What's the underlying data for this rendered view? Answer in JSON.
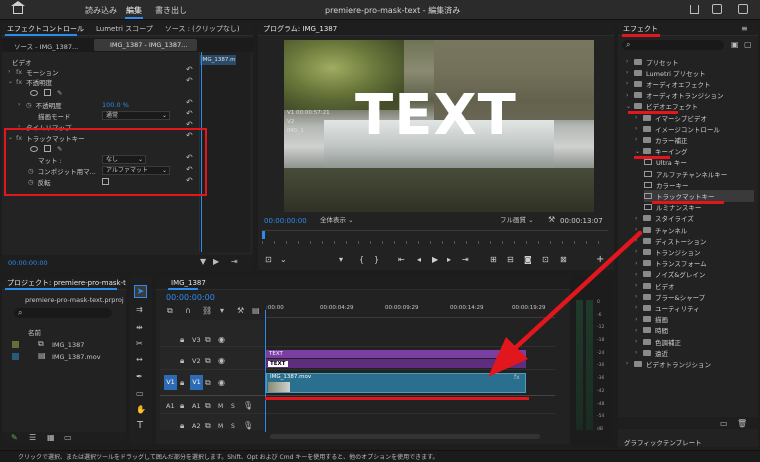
{
  "app": {
    "title": "premiere-pro-mask-text - 編集済み",
    "nav": [
      "読み込み",
      "編集",
      "書き出し"
    ],
    "active_nav": "編集"
  },
  "effect_controls": {
    "tabs": [
      "エフェクトコントロール",
      "Lumetri スコープ",
      "ソース : (クリップなし)"
    ],
    "source_label": "ソース - IMG_1387...",
    "clip_label": "IMG_1387 - IMG_1387...",
    "clip_mini": "IMG_1387.m",
    "video_label": "ビデオ",
    "rows": {
      "motion": "モーション",
      "opacity_section": "不透明度",
      "opacity": "不透明度",
      "opacity_value": "100.0 %",
      "blend": "描画モード",
      "blend_value": "通常",
      "remap": "タイムリマップ",
      "track_matte": "トラックマットキー",
      "matte": "マット :",
      "matte_value": "なし",
      "composite": "コンポジット用マ...",
      "composite_value": "アルファマット",
      "reverse": "反転"
    },
    "timecode": "00:00:00:00"
  },
  "program": {
    "title": "プログラム: IMG_1387",
    "overlay_text": "TEXT",
    "timecode_left": "00:00:00:00",
    "fit": "全体表示",
    "quality": "フル画質",
    "timecode_right": "00:00:13:07",
    "info_lines": [
      "V1 00:00:57:21",
      "V2",
      "IMG_1"
    ]
  },
  "project": {
    "title": "プロジェクト: premiere-pro-mask-text",
    "file": "premiere-pro-mask-text.prproj",
    "col_name": "名前",
    "items": [
      "IMG_1387",
      "IMG_1387.mov"
    ]
  },
  "timeline": {
    "title": "IMG_1387",
    "timecode": "00:00:00:00",
    "ruler": [
      ":00:00",
      "00:00:04:29",
      "00:00:09:29",
      "00:00:14:29",
      "00:00:19:29"
    ],
    "tracks": {
      "v3": "V3",
      "v2": "V2",
      "v1": "V1",
      "a1": "A1",
      "a2": "A2",
      "v1_src": "V1",
      "a1_src": "A1"
    },
    "clips": {
      "text_top": "TEXT",
      "text_inner": "TEXT",
      "video": "IMG_1387.mov"
    }
  },
  "effects": {
    "title": "エフェクト",
    "items": [
      {
        "label": "プリセット",
        "level": 0,
        "open": false
      },
      {
        "label": "Lumetri プリセット",
        "level": 0,
        "open": false
      },
      {
        "label": "オーディオエフェクト",
        "level": 0,
        "open": false
      },
      {
        "label": "オーディオトランジション",
        "level": 0,
        "open": false
      },
      {
        "label": "ビデオエフェクト",
        "level": 0,
        "open": true
      },
      {
        "label": "イマーシブビデオ",
        "level": 1,
        "open": false
      },
      {
        "label": "イメージコントロール",
        "level": 1,
        "open": false
      },
      {
        "label": "カラー補正",
        "level": 1,
        "open": false
      },
      {
        "label": "キーイング",
        "level": 1,
        "open": true
      },
      {
        "label": "Ultra キー",
        "level": 2,
        "fx": true
      },
      {
        "label": "アルファチャンネルキー",
        "level": 2,
        "fx": true
      },
      {
        "label": "カラーキー",
        "level": 2,
        "fx": true
      },
      {
        "label": "トラックマットキー",
        "level": 2,
        "fx": true,
        "selected": true
      },
      {
        "label": "ルミナンスキー",
        "level": 2,
        "fx": true
      },
      {
        "label": "スタイライズ",
        "level": 1,
        "open": false
      },
      {
        "label": "チャンネル",
        "level": 1,
        "open": false
      },
      {
        "label": "ディストーション",
        "level": 1,
        "open": false
      },
      {
        "label": "トランジション",
        "level": 1,
        "open": false
      },
      {
        "label": "トランスフォーム",
        "level": 1,
        "open": false
      },
      {
        "label": "ノイズ&グレイン",
        "level": 1,
        "open": false
      },
      {
        "label": "ビデオ",
        "level": 1,
        "open": false
      },
      {
        "label": "ブラー&シャープ",
        "level": 1,
        "open": false
      },
      {
        "label": "ユーティリティ",
        "level": 1,
        "open": false
      },
      {
        "label": "描画",
        "level": 1,
        "open": false
      },
      {
        "label": "時間",
        "level": 1,
        "open": false
      },
      {
        "label": "色調補正",
        "level": 1,
        "open": false
      },
      {
        "label": "遠近",
        "level": 1,
        "open": false
      },
      {
        "label": "ビデオトランジション",
        "level": 0,
        "open": false
      }
    ],
    "graphic_template": "グラフィックテンプレート"
  },
  "status": {
    "text": "クリックで選択、または選択ツールをドラッグして囲んだ部分を選択します。Shift、Opt および Cmd キーを使用すると、他のオプションを使用できます。"
  },
  "colors": {
    "accent": "#2d8ceb",
    "highlight": "#e2161d",
    "video_clip": "#2a6f8e",
    "text_clip": "#7b3fa2"
  },
  "audio_meter": {
    "labels": [
      "0",
      "-6",
      "-12",
      "-18",
      "-24",
      "-30",
      "-36",
      "-42",
      "-48",
      "-54",
      "dB"
    ]
  }
}
